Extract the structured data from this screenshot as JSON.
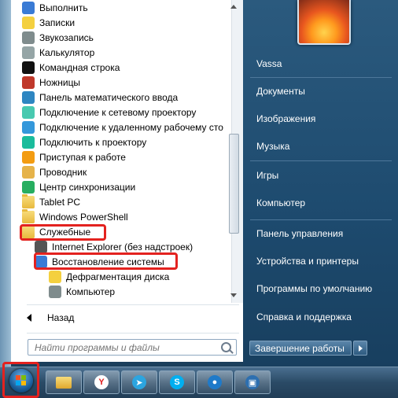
{
  "programs": [
    {
      "label": "Выполнить",
      "icon": "run-icon"
    },
    {
      "label": "Записки",
      "icon": "sticky-notes-icon"
    },
    {
      "label": "Звукозапись",
      "icon": "microphone-icon"
    },
    {
      "label": "Калькулятор",
      "icon": "calculator-icon"
    },
    {
      "label": "Командная строка",
      "icon": "command-prompt-icon"
    },
    {
      "label": "Ножницы",
      "icon": "scissors-icon"
    },
    {
      "label": "Панель математического ввода",
      "icon": "math-input-icon"
    },
    {
      "label": "Подключение к сетевому проектору",
      "icon": "network-projector-icon"
    },
    {
      "label": "Подключение к удаленному рабочему сто",
      "icon": "remote-desktop-icon"
    },
    {
      "label": "Подключить к проектору",
      "icon": "projector-icon"
    },
    {
      "label": "Приступая к работе",
      "icon": "getting-started-icon"
    },
    {
      "label": "Проводник",
      "icon": "explorer-folder-icon"
    },
    {
      "label": "Центр синхронизации",
      "icon": "sync-center-icon"
    },
    {
      "label": "Tablet PC",
      "icon": "folder-icon"
    },
    {
      "label": "Windows PowerShell",
      "icon": "folder-icon"
    },
    {
      "label": "Служебные",
      "icon": "folder-icon"
    },
    {
      "label": "Internet Explorer (без надстроек)",
      "icon": "internet-explorer-icon"
    },
    {
      "label": "Восстановление системы",
      "icon": "system-restore-icon"
    },
    {
      "label": "Дефрагментация диска",
      "icon": "defragment-icon"
    },
    {
      "label": "Компьютер",
      "icon": "computer-icon"
    }
  ],
  "back_label": "Назад",
  "search_placeholder": "Найти программы и файлы",
  "right_items": [
    "Vassa",
    "Документы",
    "Изображения",
    "Музыка",
    "Игры",
    "Компьютер",
    "Панель управления",
    "Устройства и принтеры",
    "Программы по умолчанию",
    "Справка и поддержка"
  ],
  "shutdown_label": "Завершение работы",
  "taskbar": [
    {
      "name": "file-explorer",
      "icon": "folder-icon"
    },
    {
      "name": "yandex-browser",
      "icon": "yandex-icon",
      "glyph": "Y",
      "color": "#ffffff",
      "fg": "#e02020"
    },
    {
      "name": "telegram",
      "icon": "telegram-icon",
      "glyph": "➤",
      "color": "#2ca5e0",
      "fg": "#ffffff"
    },
    {
      "name": "skype",
      "icon": "skype-icon",
      "glyph": "S",
      "color": "#00aff0",
      "fg": "#ffffff"
    },
    {
      "name": "app-blue",
      "icon": "cloud-icon",
      "glyph": "●",
      "color": "#1f7ac9",
      "fg": "#ffffff"
    },
    {
      "name": "app-remote",
      "icon": "remote-icon",
      "glyph": "▣",
      "color": "#2d6fb0",
      "fg": "#ffffff"
    }
  ],
  "colors": {
    "highlight": "#e3221f",
    "accent": "#2b5a7e"
  }
}
